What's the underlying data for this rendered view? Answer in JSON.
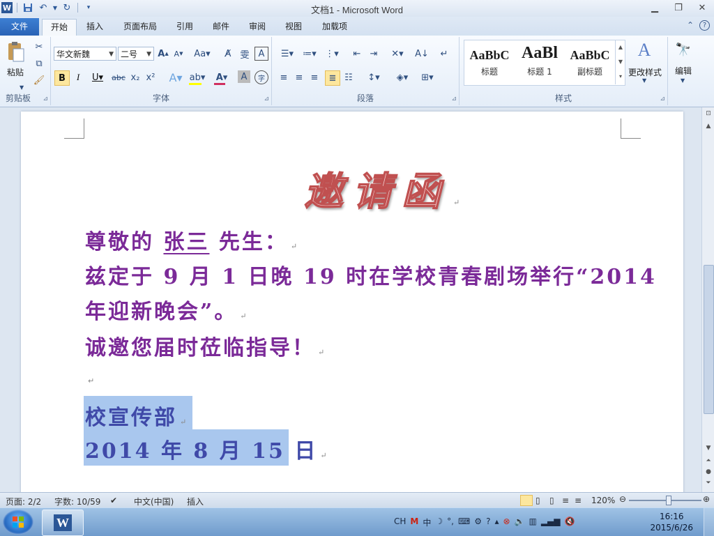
{
  "window": {
    "title": "文档1 - Microsoft Word",
    "app_icon": "word-icon",
    "controls": [
      "minimize",
      "restore",
      "close"
    ]
  },
  "quick_access": [
    "save-icon",
    "undo-icon",
    "redo-icon",
    "customize-qat-icon"
  ],
  "tabs": [
    {
      "label": "文件"
    },
    {
      "label": "开始",
      "active": true
    },
    {
      "label": "插入"
    },
    {
      "label": "页面布局"
    },
    {
      "label": "引用"
    },
    {
      "label": "邮件"
    },
    {
      "label": "审阅"
    },
    {
      "label": "视图"
    },
    {
      "label": "加载项"
    }
  ],
  "ribbon": {
    "clipboard": {
      "label": "剪贴板",
      "paste_label": "粘贴"
    },
    "font": {
      "label": "字体",
      "font_name": "华文新魏",
      "font_size": "二号",
      "font_color": "#d03060",
      "highlight_color": "#ffff00"
    },
    "paragraph": {
      "label": "段落"
    },
    "styles": {
      "label": "样式",
      "items": [
        {
          "preview": "AaBbC",
          "name": "标题"
        },
        {
          "preview": "AaBl",
          "name": "标题 1"
        },
        {
          "preview": "AaBbC",
          "name": "副标题"
        }
      ],
      "change_styles": "更改样式"
    },
    "editing": {
      "label": "编辑"
    }
  },
  "document": {
    "heading": "邀请函",
    "salutation_prefix": "尊敬的",
    "recipient": "张三",
    "salutation_suffix": "先生：",
    "body_line1": "兹定于 9 月 1 日晚 19 时在学校青春剧场举行“2014",
    "body_line2": "年迎新晚会”。",
    "body_line3": "诚邀您届时莅临指导！",
    "signature": "校宣传部",
    "date": "2014 年 8 月 15 日",
    "paragraph_mark": "↵",
    "colors": {
      "body": "#7b2a98",
      "signature": "#3f49a8",
      "heading_fill": "#f6d4d4",
      "heading_stroke": "#c05050",
      "selection": "#a9c7ee"
    }
  },
  "statusbar": {
    "page": "页面: 2/2",
    "words": "字数: 10/59",
    "language": "中文(中国)",
    "mode": "插入",
    "zoom": "120%"
  },
  "taskbar": {
    "ime": "CH",
    "time": "16:16",
    "date": "2015/6/26"
  }
}
